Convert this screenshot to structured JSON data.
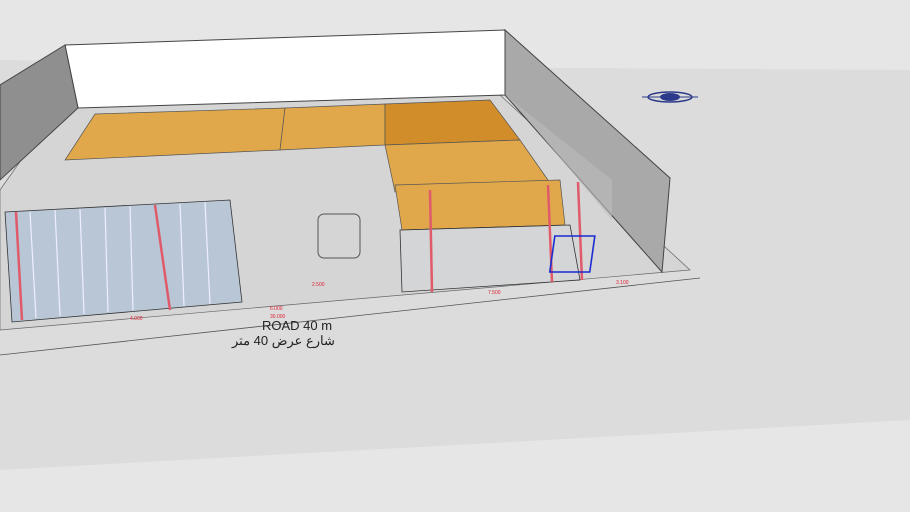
{
  "road": {
    "label": "ROAD 40 m",
    "label_ar": "شارع عرض 40 متر"
  },
  "dimensions": [
    "30.000",
    "6.000",
    "4.000",
    "2.500",
    "7.500",
    "3.100"
  ],
  "colors": {
    "ground": "#e6e6e6",
    "plot": "#d9d9d9",
    "wall": "#ffffff",
    "wall_side": "#8f8f8f",
    "room": "#e0a84a",
    "room_dark": "#c97f1c",
    "glass": "#b8c6d6",
    "column": "#e05a6a",
    "compass": "#2b3a8a",
    "fixture": "#1a2bd0"
  }
}
